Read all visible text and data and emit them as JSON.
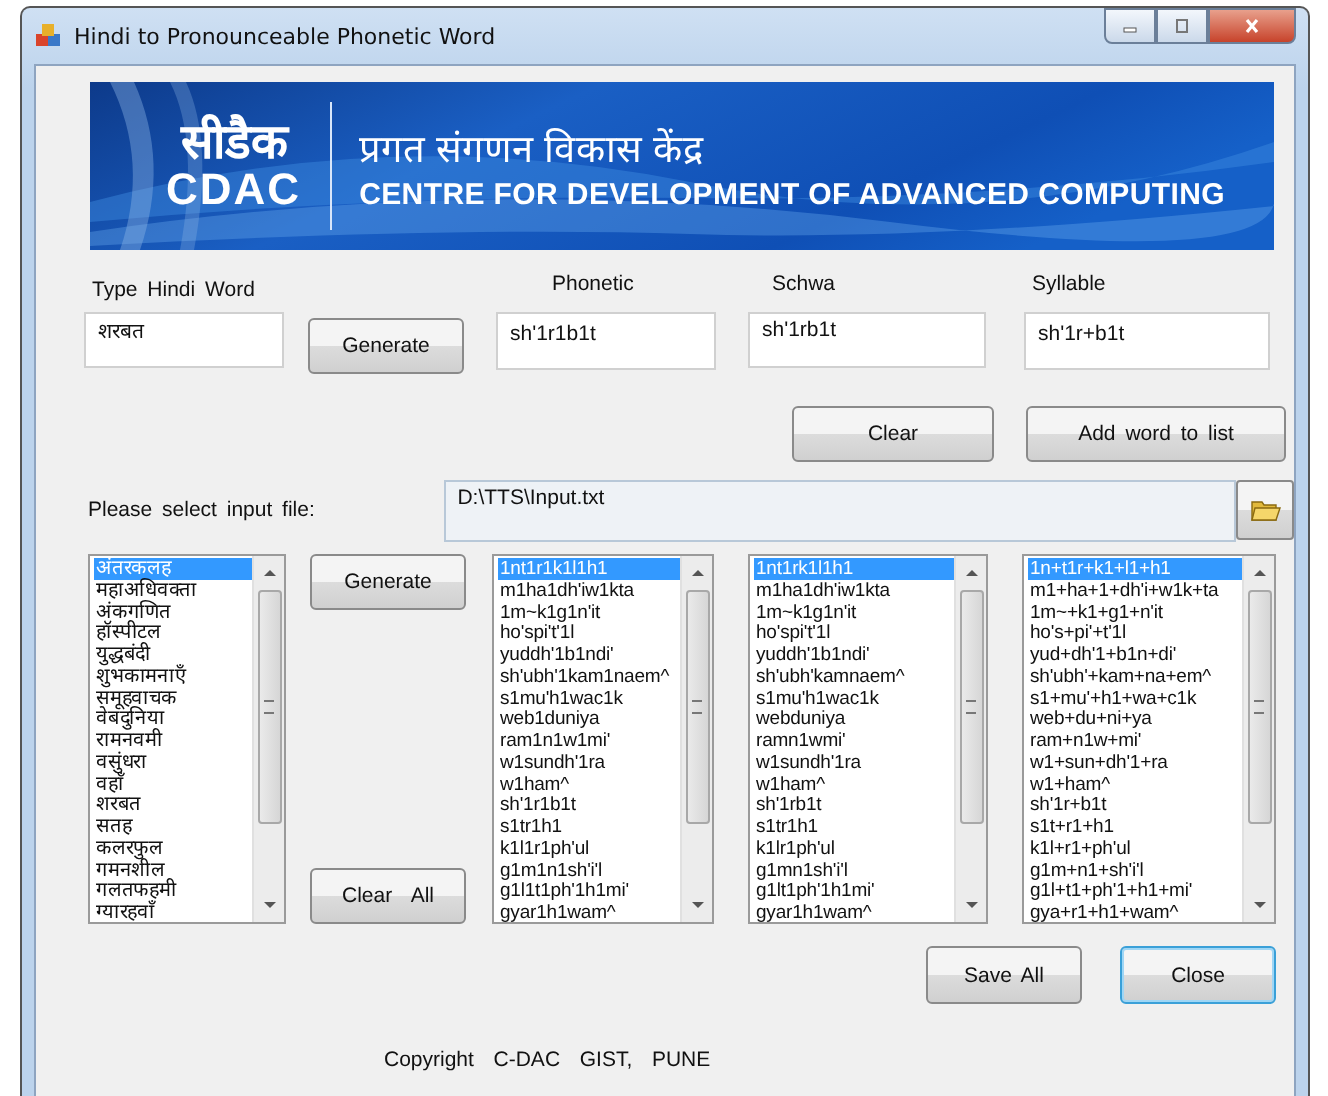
{
  "window": {
    "title": "Hindi to Pronounceable Phonetic Word"
  },
  "banner": {
    "logo_hindi": "सीडैक",
    "logo_latin": "CDAC",
    "title_hindi": "प्रगत संगणन विकास केंद्र",
    "title_english": "CENTRE FOR DEVELOPMENT OF ADVANCED COMPUTING"
  },
  "word_entry": {
    "label": "Type Hindi Word",
    "value": "शरबत",
    "generate_button": "Generate"
  },
  "outputs": [
    {
      "label": "Phonetic",
      "value": "sh'1r1b1t"
    },
    {
      "label": "Schwa",
      "value": "sh'1rb1t"
    },
    {
      "label": "Syllable",
      "value": "sh'1r+b1t"
    }
  ],
  "clear_button": "Clear",
  "add_button": "Add word to list",
  "input_file": {
    "label": "Please select input file:",
    "value": "D:\\TTS\\Input.txt"
  },
  "list_generate_button": "Generate",
  "clear_all_button": "Clear  All",
  "lists": [
    {
      "items": [
        {
          "text": "अंतरकलह",
          "selected": true
        },
        {
          "text": "महाअधिवक्ता",
          "selected": false
        },
        {
          "text": "अंकगणित",
          "selected": false
        },
        {
          "text": "हॉस्पीटल",
          "selected": false
        },
        {
          "text": "युद्धबंदी",
          "selected": false
        },
        {
          "text": "शुभकामनाएँ",
          "selected": false
        },
        {
          "text": "समूहवाचक",
          "selected": false
        },
        {
          "text": "वेबदुनिया",
          "selected": false
        },
        {
          "text": "रामनवमी",
          "selected": false
        },
        {
          "text": "वसुंधरा",
          "selected": false
        },
        {
          "text": "वहाँ",
          "selected": false
        },
        {
          "text": "शरबत",
          "selected": false
        },
        {
          "text": "सतह",
          "selected": false
        },
        {
          "text": "कलरफुल",
          "selected": false
        },
        {
          "text": "गमनशील",
          "selected": false
        },
        {
          "text": "गलतफहमी",
          "selected": false
        },
        {
          "text": "ग्यारहवाँ",
          "selected": false
        }
      ]
    },
    {
      "items": [
        {
          "text": "1nt1r1k1l1h1",
          "selected": true
        },
        {
          "text": "m1ha1dh'iw1kta",
          "selected": false
        },
        {
          "text": "1m~k1g1n'it",
          "selected": false
        },
        {
          "text": "ho'spi't'1l",
          "selected": false
        },
        {
          "text": "yuddh'1b1ndi'",
          "selected": false
        },
        {
          "text": "sh'ubh'1kam1naem^",
          "selected": false
        },
        {
          "text": "s1mu'h1wac1k",
          "selected": false
        },
        {
          "text": "web1duniya",
          "selected": false
        },
        {
          "text": "ram1n1w1mi'",
          "selected": false
        },
        {
          "text": "w1sundh'1ra",
          "selected": false
        },
        {
          "text": "w1ham^",
          "selected": false
        },
        {
          "text": "sh'1r1b1t",
          "selected": false
        },
        {
          "text": "s1tr1h1",
          "selected": false
        },
        {
          "text": "k1l1r1ph'ul",
          "selected": false
        },
        {
          "text": "g1m1n1sh'i'l",
          "selected": false
        },
        {
          "text": "g1l1t1ph'1h1mi'",
          "selected": false
        },
        {
          "text": "gyar1h1wam^",
          "selected": false
        }
      ]
    },
    {
      "items": [
        {
          "text": "1nt1rk1l1h1",
          "selected": true
        },
        {
          "text": "m1ha1dh'iw1kta",
          "selected": false
        },
        {
          "text": "1m~k1g1n'it",
          "selected": false
        },
        {
          "text": "ho'spi't'1l",
          "selected": false
        },
        {
          "text": "yuddh'1b1ndi'",
          "selected": false
        },
        {
          "text": "sh'ubh'kamnaem^",
          "selected": false
        },
        {
          "text": "s1mu'h1wac1k",
          "selected": false
        },
        {
          "text": "webduniya",
          "selected": false
        },
        {
          "text": "ramn1wmi'",
          "selected": false
        },
        {
          "text": "w1sundh'1ra",
          "selected": false
        },
        {
          "text": "w1ham^",
          "selected": false
        },
        {
          "text": "sh'1rb1t",
          "selected": false
        },
        {
          "text": "s1tr1h1",
          "selected": false
        },
        {
          "text": "k1lr1ph'ul",
          "selected": false
        },
        {
          "text": "g1mn1sh'i'l",
          "selected": false
        },
        {
          "text": "g1lt1ph'1h1mi'",
          "selected": false
        },
        {
          "text": "gyar1h1wam^",
          "selected": false
        }
      ]
    },
    {
      "items": [
        {
          "text": "1n+t1r+k1+l1+h1",
          "selected": true
        },
        {
          "text": "m1+ha+1+dh'i+w1k+ta",
          "selected": false
        },
        {
          "text": "1m~+k1+g1+n'it",
          "selected": false
        },
        {
          "text": "ho's+pi'+t'1l",
          "selected": false
        },
        {
          "text": "yud+dh'1+b1n+di'",
          "selected": false
        },
        {
          "text": "sh'ubh'+kam+na+em^",
          "selected": false
        },
        {
          "text": "s1+mu'+h1+wa+c1k",
          "selected": false
        },
        {
          "text": "web+du+ni+ya",
          "selected": false
        },
        {
          "text": "ram+n1w+mi'",
          "selected": false
        },
        {
          "text": "w1+sun+dh'1+ra",
          "selected": false
        },
        {
          "text": "w1+ham^",
          "selected": false
        },
        {
          "text": "sh'1r+b1t",
          "selected": false
        },
        {
          "text": "s1t+r1+h1",
          "selected": false
        },
        {
          "text": "k1l+r1+ph'ul",
          "selected": false
        },
        {
          "text": "g1m+n1+sh'i'l",
          "selected": false
        },
        {
          "text": "g1l+t1+ph'1+h1+mi'",
          "selected": false
        },
        {
          "text": "gya+r1+h1+wam^",
          "selected": false
        }
      ]
    }
  ],
  "save_all_button": "Save All",
  "close_button": "Close",
  "copyright": "Copyright  C-DAC  GIST,  PUNE"
}
